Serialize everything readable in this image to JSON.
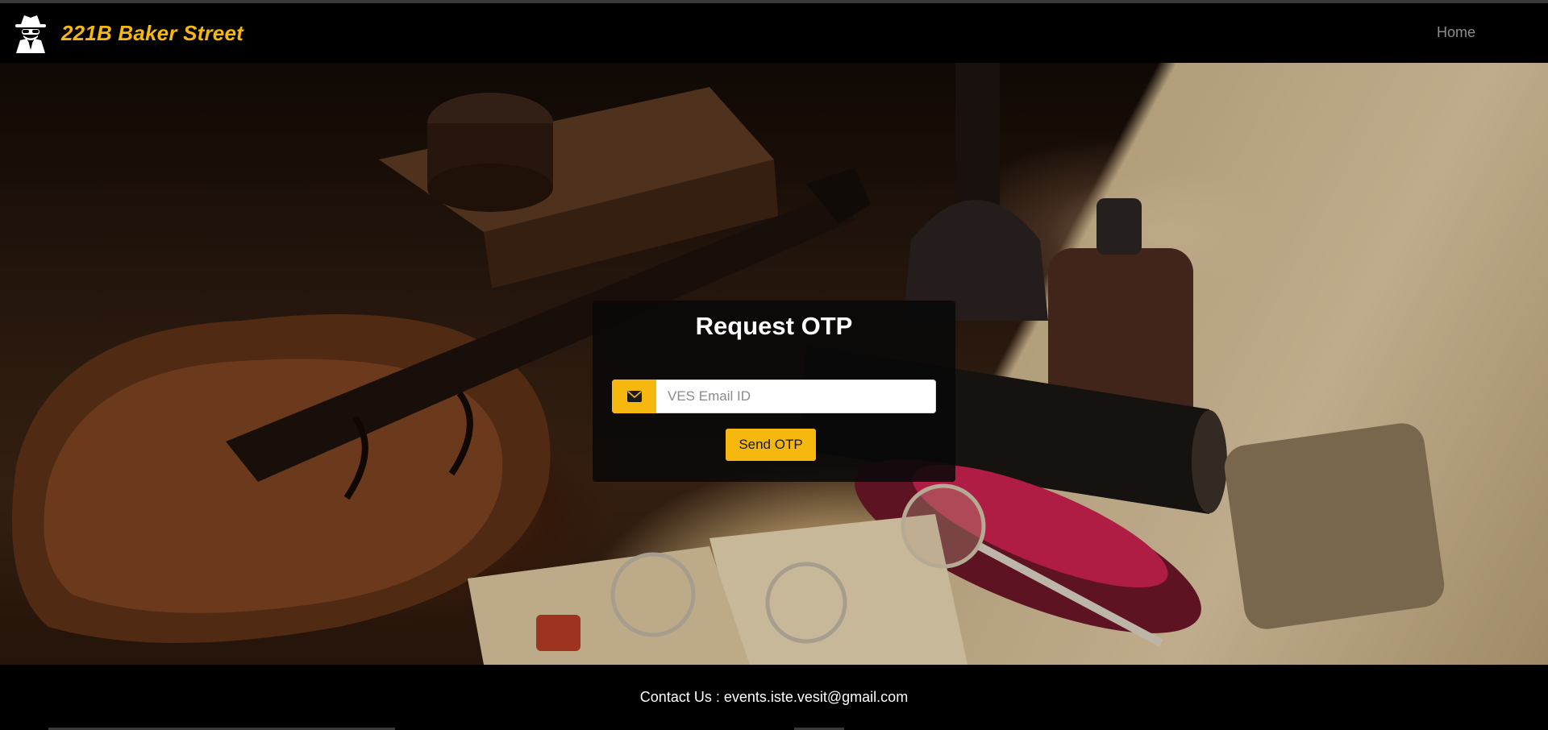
{
  "brand": {
    "title": "221B Baker Street",
    "icon": "detective-icon",
    "accent": "#f6b80f"
  },
  "nav": {
    "home_label": "Home"
  },
  "card": {
    "title": "Request OTP",
    "email_icon": "envelope-icon",
    "email_placeholder": "VES Email ID",
    "email_value": "",
    "send_label": "Send OTP"
  },
  "footer": {
    "contact": "Contact Us : events.iste.vesit@gmail.com"
  }
}
